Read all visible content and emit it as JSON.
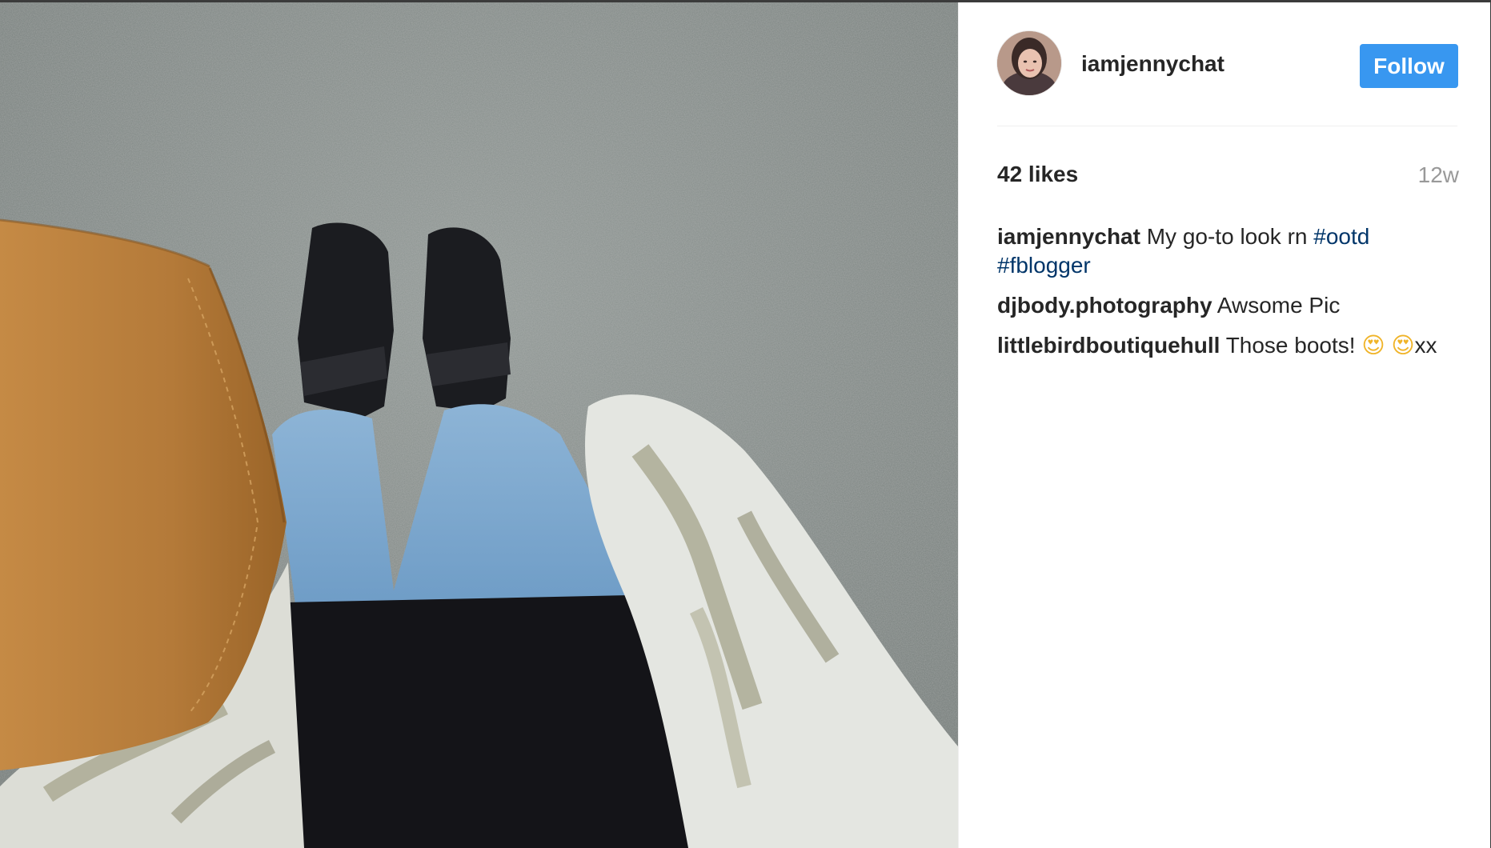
{
  "post": {
    "author": "iamjennychat",
    "follow_label": "Follow",
    "likes": "42 likes",
    "age": "12w",
    "accent_color": "#3897f0",
    "hashtag_color": "#003569"
  },
  "comments": [
    {
      "user": "iamjennychat",
      "text": "My go-to look rn",
      "tag1": "#ootd",
      "tag2": "#fblogger"
    },
    {
      "user": "djbody.photography",
      "text": "Awsome Pic"
    },
    {
      "user": "littlebirdboutiquehull",
      "text": "Those boots!",
      "emoji1": "😍",
      "emoji2": "😍",
      "tail": "xx"
    }
  ]
}
